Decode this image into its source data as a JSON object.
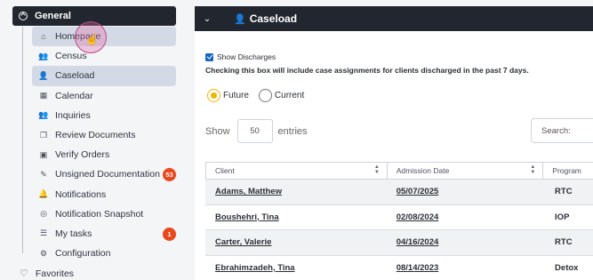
{
  "sidebar": {
    "section_label": "General",
    "items": [
      {
        "label": "Homepage",
        "icon": "home-icon",
        "active": true
      },
      {
        "label": "Census",
        "icon": "users-icon"
      },
      {
        "label": "Caseload",
        "icon": "user-icon",
        "active": true
      },
      {
        "label": "Calendar",
        "icon": "calendar-icon"
      },
      {
        "label": "Inquiries",
        "icon": "people-icon"
      },
      {
        "label": "Review Documents",
        "icon": "documents-icon"
      },
      {
        "label": "Verify Orders",
        "icon": "calendar-check-icon"
      },
      {
        "label": "Unsigned Documentation",
        "icon": "pen-icon",
        "badge": "53"
      },
      {
        "label": "Notifications",
        "icon": "bell-icon"
      },
      {
        "label": "Notification Snapshot",
        "icon": "bell-circle-icon"
      },
      {
        "label": "My tasks",
        "icon": "tasks-icon",
        "badge": "1"
      },
      {
        "label": "Configuration",
        "icon": "gear-icon"
      }
    ],
    "favorites_label": "Favorites"
  },
  "header": {
    "title": "Caseload"
  },
  "filters": {
    "show_discharges_label": "Show Discharges",
    "show_discharges_checked": true,
    "hint": "Checking this box will include case assignments for clients discharged in the past 7 days.",
    "radio_future": "Future",
    "radio_current": "Current",
    "selected": "Future"
  },
  "entries": {
    "show_label": "Show",
    "value": "50",
    "suffix": "entries"
  },
  "search": {
    "label": "Search:"
  },
  "table": {
    "columns": [
      "Client",
      "Admission Date",
      "Program"
    ],
    "rows": [
      {
        "client": "Adams, Matthew",
        "date": "05/07/2025",
        "program": "RTC"
      },
      {
        "client": "Boushehri, Tina",
        "date": "02/08/2024",
        "program": "IOP"
      },
      {
        "client": "Carter, Valerie",
        "date": "04/16/2024",
        "program": "RTC"
      },
      {
        "client": "Ebrahimzadeh, Tina",
        "date": "08/14/2023",
        "program": "Detox"
      }
    ]
  },
  "colors": {
    "dark_header": "#22262e",
    "accent_yellow": "#f5b301",
    "badge_red": "#e8481c",
    "checkbox_blue": "#1565c0"
  }
}
